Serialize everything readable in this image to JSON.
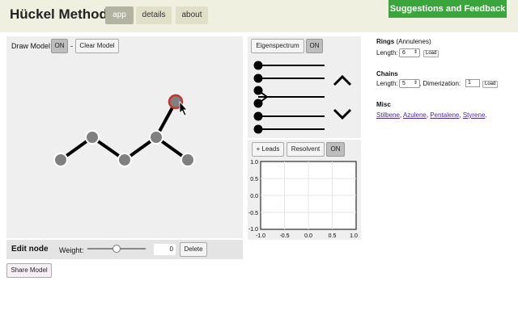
{
  "header": {
    "title": "Hückel Method",
    "tabs": [
      {
        "label": "app",
        "active": true
      },
      {
        "label": "details",
        "active": false
      },
      {
        "label": "about",
        "active": false
      }
    ],
    "feedback_label": "Suggestions and Feedback"
  },
  "draw_panel": {
    "draw_model_label": "Draw Model",
    "draw_toggle": "ON",
    "separator": "-",
    "clear_label": "Clear Model"
  },
  "edit_node": {
    "title": "Edit node",
    "weight_label": "Weight:",
    "weight_value": "0",
    "weight_slider_fraction": 0.5,
    "delete_label": "Delete"
  },
  "share_label": "Share Model",
  "eigen_panel": {
    "button_label": "Eigenspectrum",
    "toggle": "ON"
  },
  "leads_panel": {
    "leads_label": "+ Leads",
    "resolvent_label": "Resolvent",
    "toggle": "ON",
    "x_ticks": [
      "-1.0",
      "-0.5",
      "0.0",
      "0.5",
      "1.0"
    ],
    "y_ticks": [
      "1.0",
      "0.5",
      "0.0",
      "-0.5",
      "-1.0"
    ]
  },
  "sidebar": {
    "rings": {
      "title": "Rings",
      "subtitle": "(Annulenes)",
      "length_label": "Length:",
      "length_value": "6",
      "load_label": "Load"
    },
    "chains": {
      "title": "Chains",
      "length_label": "Length:",
      "length_value": "5",
      "dimerization_label": ", Dimerization:",
      "dimerization_value": "1",
      "load_label": "Load"
    },
    "misc": {
      "title": "Misc",
      "links": [
        "Stilbene",
        "Azulene",
        "Pentalene",
        "Styrene"
      ],
      "sep1": ",",
      "sep2": ",",
      "sep3": ",",
      "end": "."
    }
  },
  "colors": {
    "topbar": "#f0f0e1",
    "feedback": "#3aa53b",
    "node": "#808080",
    "selected_ring": "#c8342c"
  }
}
